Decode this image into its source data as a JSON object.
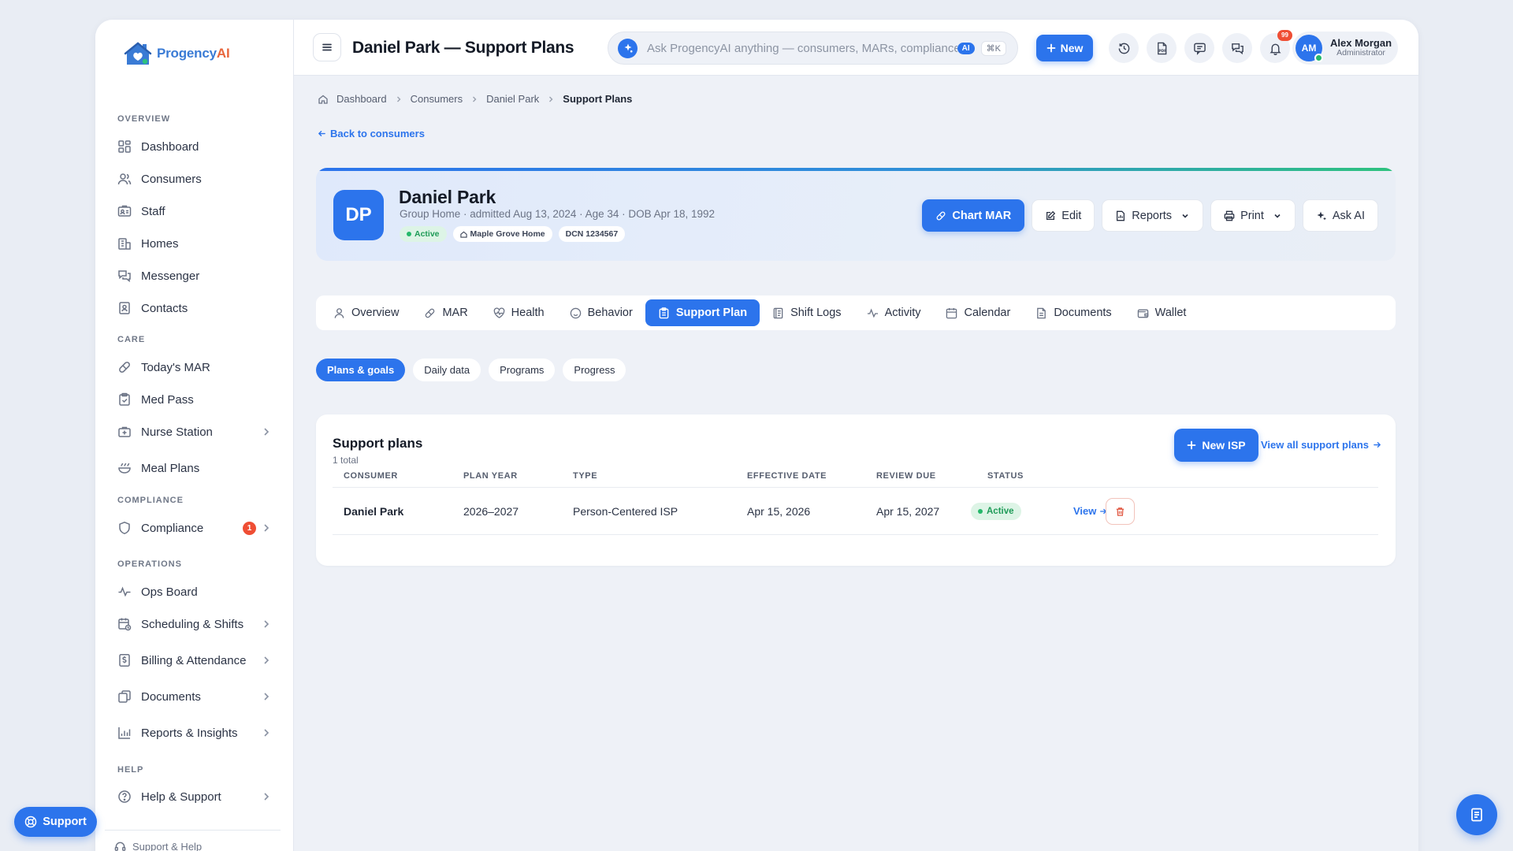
{
  "brand": {
    "name_main": "Progency",
    "name_accent": "AI"
  },
  "topbar": {
    "title": "Daniel Park — Support Plans",
    "search_placeholder": "Ask ProgencyAI anything — consumers, MARs, compliance…",
    "search_ai_badge": "AI",
    "search_shortcut": "⌘K",
    "new_label": "New",
    "notifications_count": "99",
    "user": {
      "initials": "AM",
      "name": "Alex Morgan",
      "role": "Administrator"
    }
  },
  "sidebar": {
    "sections": {
      "overview": "OVERVIEW",
      "care": "CARE",
      "compliance": "COMPLIANCE",
      "operations": "OPERATIONS",
      "help": "HELP"
    },
    "items": {
      "dashboard": "Dashboard",
      "consumers": "Consumers",
      "staff": "Staff",
      "homes": "Homes",
      "messenger": "Messenger",
      "contacts": "Contacts",
      "todays_mar": "Today's MAR",
      "med_pass": "Med Pass",
      "nurse_station": "Nurse Station",
      "meal_plans": "Meal Plans",
      "compliance": "Compliance",
      "compliance_badge": "1",
      "ops_board": "Ops Board",
      "scheduling": "Scheduling & Shifts",
      "billing": "Billing & Attendance",
      "documents": "Documents",
      "reports": "Reports & Insights",
      "help_support": "Help & Support"
    },
    "footer": "Support & Help"
  },
  "breadcrumb": [
    "Dashboard",
    "Consumers",
    "Daniel Park",
    "Support Plans"
  ],
  "back_link": "Back to consumers",
  "profile": {
    "initials": "DP",
    "name": "Daniel Park",
    "subtitle": "Group Home · admitted Aug 13, 2024 · Age 34 · DOB Apr 18, 1992",
    "status": "Active",
    "home": "Maple Grove Home",
    "dcn": "DCN 1234567",
    "actions": {
      "chart_mar": "Chart MAR",
      "edit": "Edit",
      "reports": "Reports",
      "print": "Print",
      "ask_ai": "Ask AI"
    }
  },
  "tabs": [
    "Overview",
    "MAR",
    "Health",
    "Behavior",
    "Support Plan",
    "Shift Logs",
    "Activity",
    "Calendar",
    "Documents",
    "Wallet"
  ],
  "active_tab": "Support Plan",
  "subtabs": [
    "Plans & goals",
    "Daily data",
    "Programs",
    "Progress"
  ],
  "support_plans": {
    "title": "Support plans",
    "count_text": "1 total",
    "new_button": "New ISP",
    "view_all": "View all support plans",
    "columns": [
      "CONSUMER",
      "PLAN YEAR",
      "TYPE",
      "EFFECTIVE DATE",
      "REVIEW DUE",
      "STATUS"
    ],
    "rows": [
      {
        "consumer": "Daniel Park",
        "plan_year": "2026–2027",
        "type": "Person-Centered ISP",
        "effective_date": "Apr 15, 2026",
        "review_due": "Apr 15, 2027",
        "status": "Active",
        "view_label": "View"
      }
    ]
  },
  "support_button": "Support",
  "colors": {
    "primary": "#2c74ec",
    "success": "#25b86a",
    "danger": "#ef4e34",
    "brand_accent": "#e8663c"
  }
}
